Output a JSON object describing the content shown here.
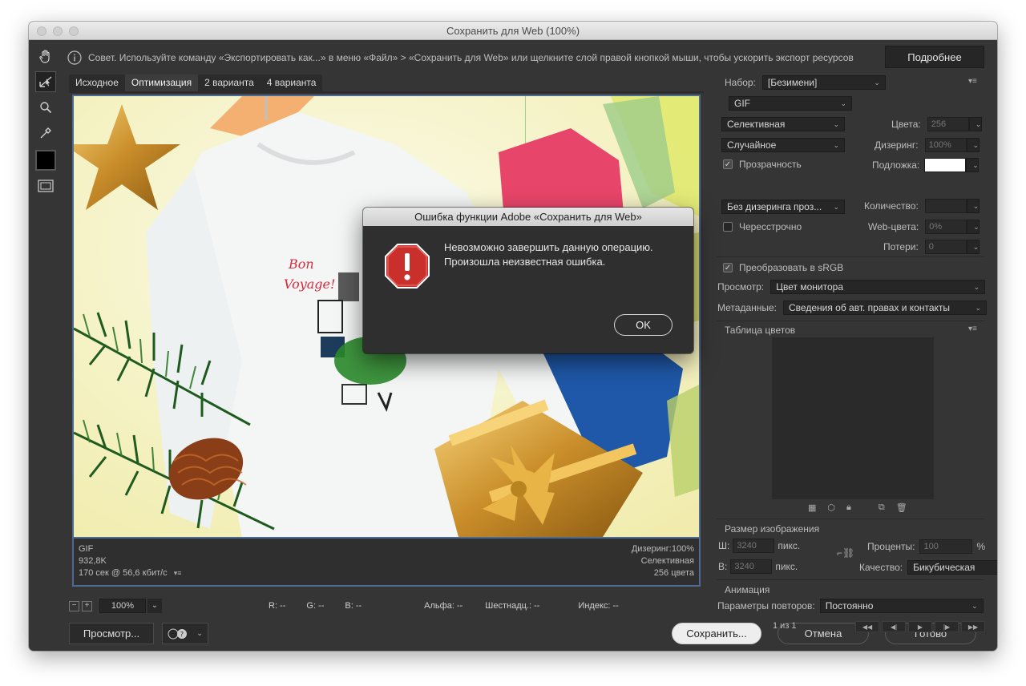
{
  "window": {
    "title": "Сохранить для Web (100%)"
  },
  "tip": {
    "text": "Совет. Используйте команду «Экспортировать как...» в меню «Файл» > «Сохранить для Web» или щелкните слой правой кнопкой мыши, чтобы ускорить экспорт ресурсов",
    "more_label": "Подробнее"
  },
  "tabs": [
    "Исходное",
    "Оптимизация",
    "2 варианта",
    "4 варианта"
  ],
  "image_info": {
    "format": "GIF",
    "size": "932,8K",
    "time": "170 сек @ 56,6 кбит/с",
    "dither": "Дизеринг:100%",
    "palette": "Селективная",
    "colors": "256 цвета"
  },
  "status": {
    "zoom": "100%",
    "r": "R: --",
    "g": "G: --",
    "b": "B: --",
    "alpha": "Альфа: --",
    "hex": "Шестнадц.: --",
    "index": "Индекс: --"
  },
  "bottom": {
    "preview": "Просмотр...",
    "save": "Сохранить...",
    "cancel": "Отмена",
    "done": "Готово"
  },
  "panel": {
    "preset_label": "Набор:",
    "preset_value": "[Безимени]",
    "format_value": "GIF",
    "reduction_value": "Селективная",
    "colors_label": "Цвета:",
    "colors_value": "256",
    "dither_algo": "Случайное",
    "dither_label": "Дизеринг:",
    "dither_value": "100%",
    "transparency_label": "Прозрачность",
    "matte_label": "Подложка:",
    "transp_dither": "Без дизеринга проз...",
    "amount_label": "Количество:",
    "interlaced_label": "Чересстрочно",
    "websnap_label": "Web-цвета:",
    "websnap_value": "0%",
    "lossy_label": "Потери:",
    "lossy_value": "0",
    "srgb_label": "Преобразовать в sRGB",
    "preview_label": "Просмотр:",
    "preview_value": "Цвет монитора",
    "meta_label": "Метаданные:",
    "meta_value": "Сведения об авт. правах и контакты",
    "color_table_label": "Таблица цветов",
    "size_label": "Размер изображения",
    "w_label": "Ш:",
    "w_value": "3240",
    "h_label": "В:",
    "h_value": "3240",
    "px": "пикс.",
    "percent_label": "Проценты:",
    "percent_value": "100",
    "percent_sign": "%",
    "quality_label": "Качество:",
    "quality_value": "Бикубическая",
    "anim_label": "Анимация",
    "loop_label": "Параметры повторов:",
    "loop_value": "Постоянно",
    "frame_counter": "1 из 1"
  },
  "dialog": {
    "title": "Ошибка функции Adobe «Сохранить для Web»",
    "line1": "Невозможно завершить данную операцию.",
    "line2": "Произошла неизвестная ошибка.",
    "ok": "OK"
  }
}
